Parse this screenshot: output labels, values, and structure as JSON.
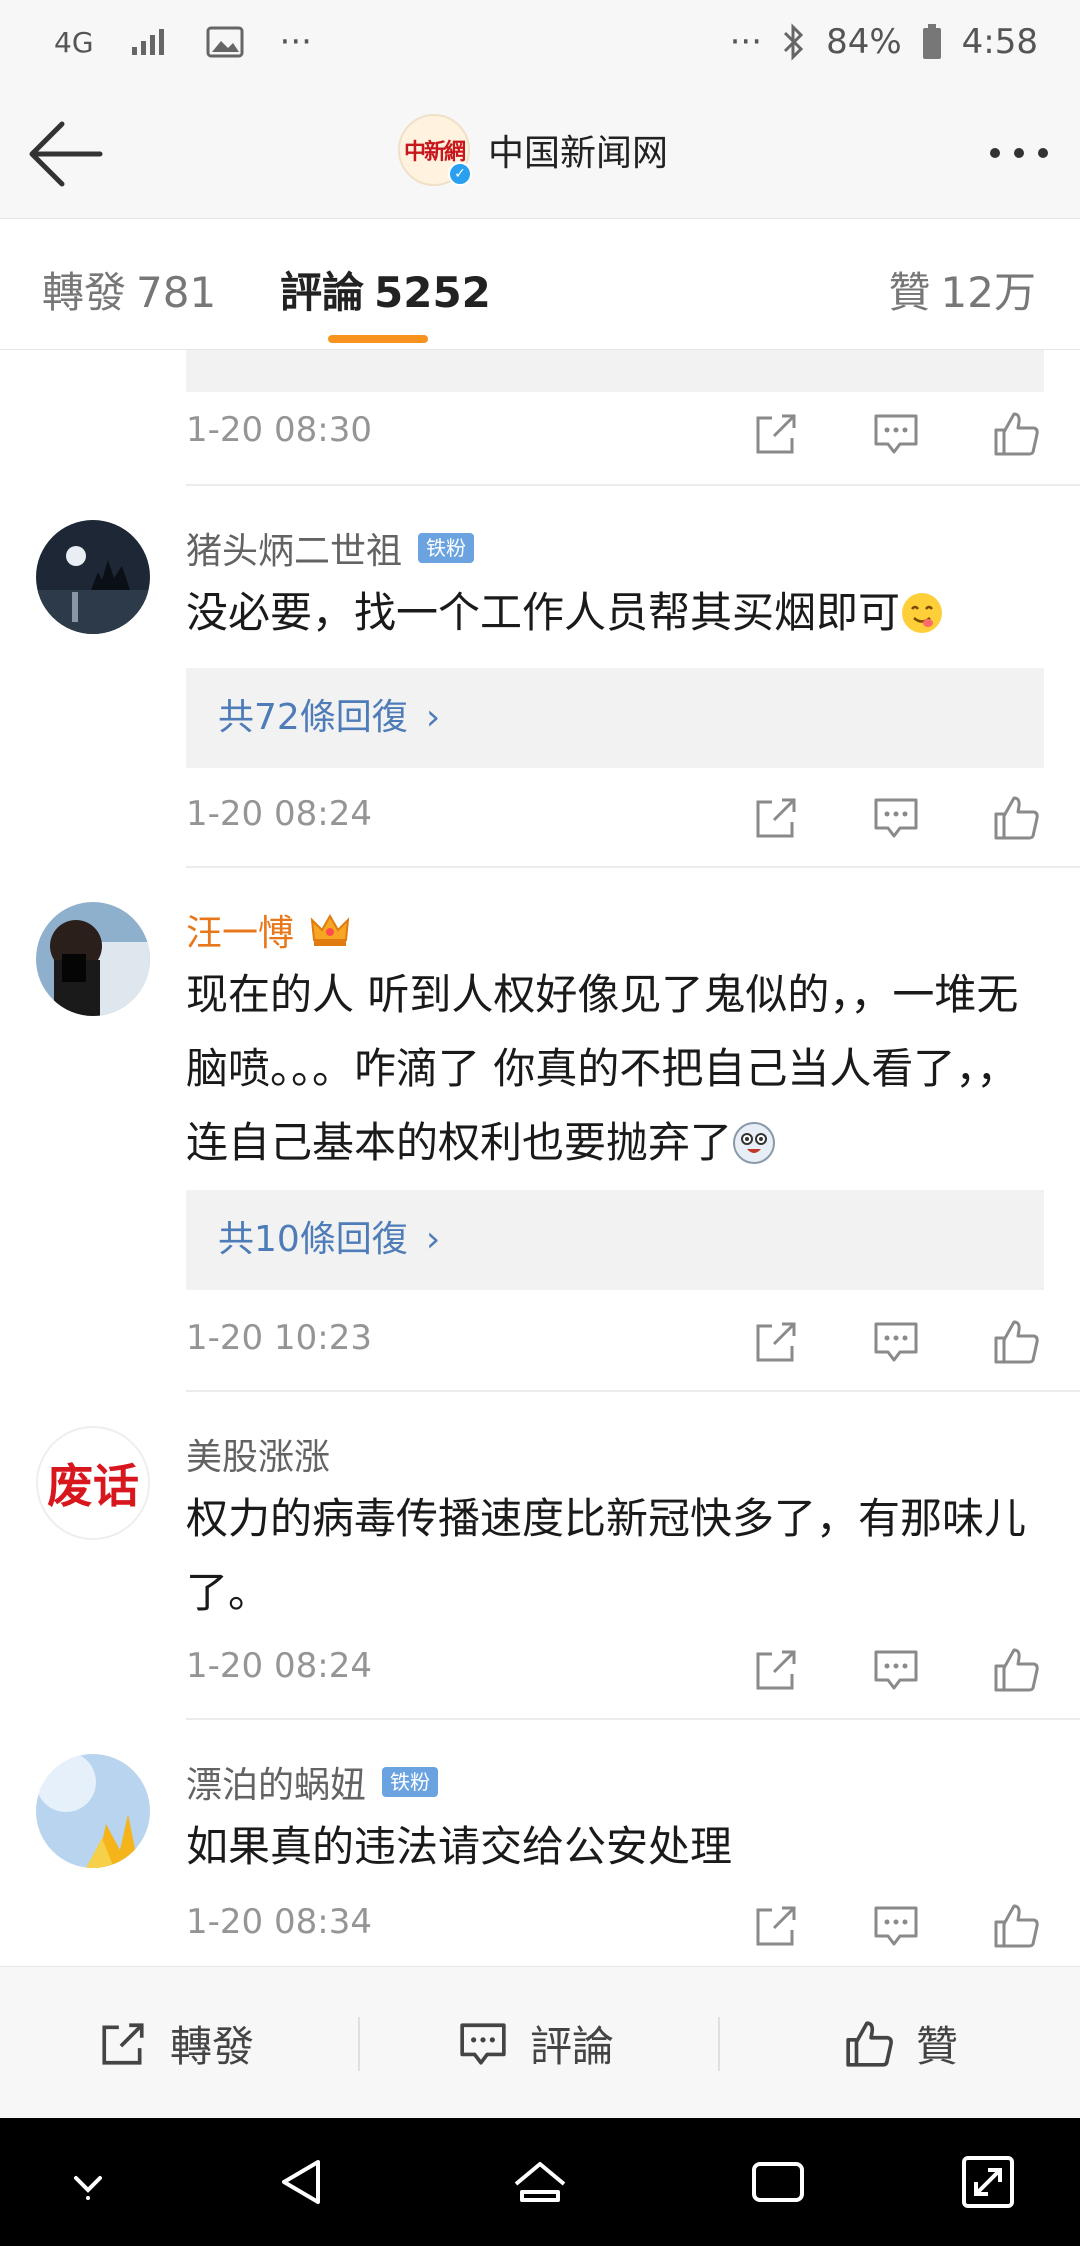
{
  "status_bar": {
    "network": "4G",
    "overflow": "···",
    "right_overflow": "···",
    "battery": "84%",
    "time": "4:58",
    "icons": [
      "signal-icon",
      "image-icon",
      "bluetooth-icon",
      "battery-icon"
    ]
  },
  "header": {
    "account_name": "中国新闻网",
    "logo_text": "中新網",
    "verified_mark": "✓"
  },
  "tabs": {
    "repost": {
      "label": "轉發",
      "count": "781"
    },
    "comment": {
      "label": "評論",
      "count": "5252"
    },
    "likes": {
      "label": "贊",
      "count": "12万"
    }
  },
  "comments": [
    {
      "time": "1-20 08:30"
    },
    {
      "user": "猪头炳二世祖",
      "badge": "铁粉",
      "text": "没必要，找一个工作人员帮其买烟即可",
      "replies": "共72條回復",
      "time": "1-20 08:24"
    },
    {
      "user": "汪一愽",
      "text": "现在的人 听到人权好像见了鬼似的，，一堆无脑喷。。。咋滴了  你真的不把自己当人看了，，连自己基本的权利也要抛弃了",
      "replies": "共10條回復",
      "time": "1-20 10:23"
    },
    {
      "user": "美股涨涨",
      "avatar_text": "废话",
      "text": "权力的病毒传播速度比新冠快多了，有那味儿了。",
      "time": "1-20 08:24"
    },
    {
      "user": "漂泊的蜗妞",
      "badge": "铁粉",
      "text": "如果真的违法请交给公安处理",
      "time": "1-20 08:34"
    }
  ],
  "bottom_bar": {
    "repost": "轉發",
    "comment": "評論",
    "like": "贊"
  },
  "colors": {
    "accent_orange": "#f7931e",
    "link_blue": "#4e7cb8",
    "vip_name": "#e8771a",
    "badge_blue": "#6aa3e0"
  }
}
